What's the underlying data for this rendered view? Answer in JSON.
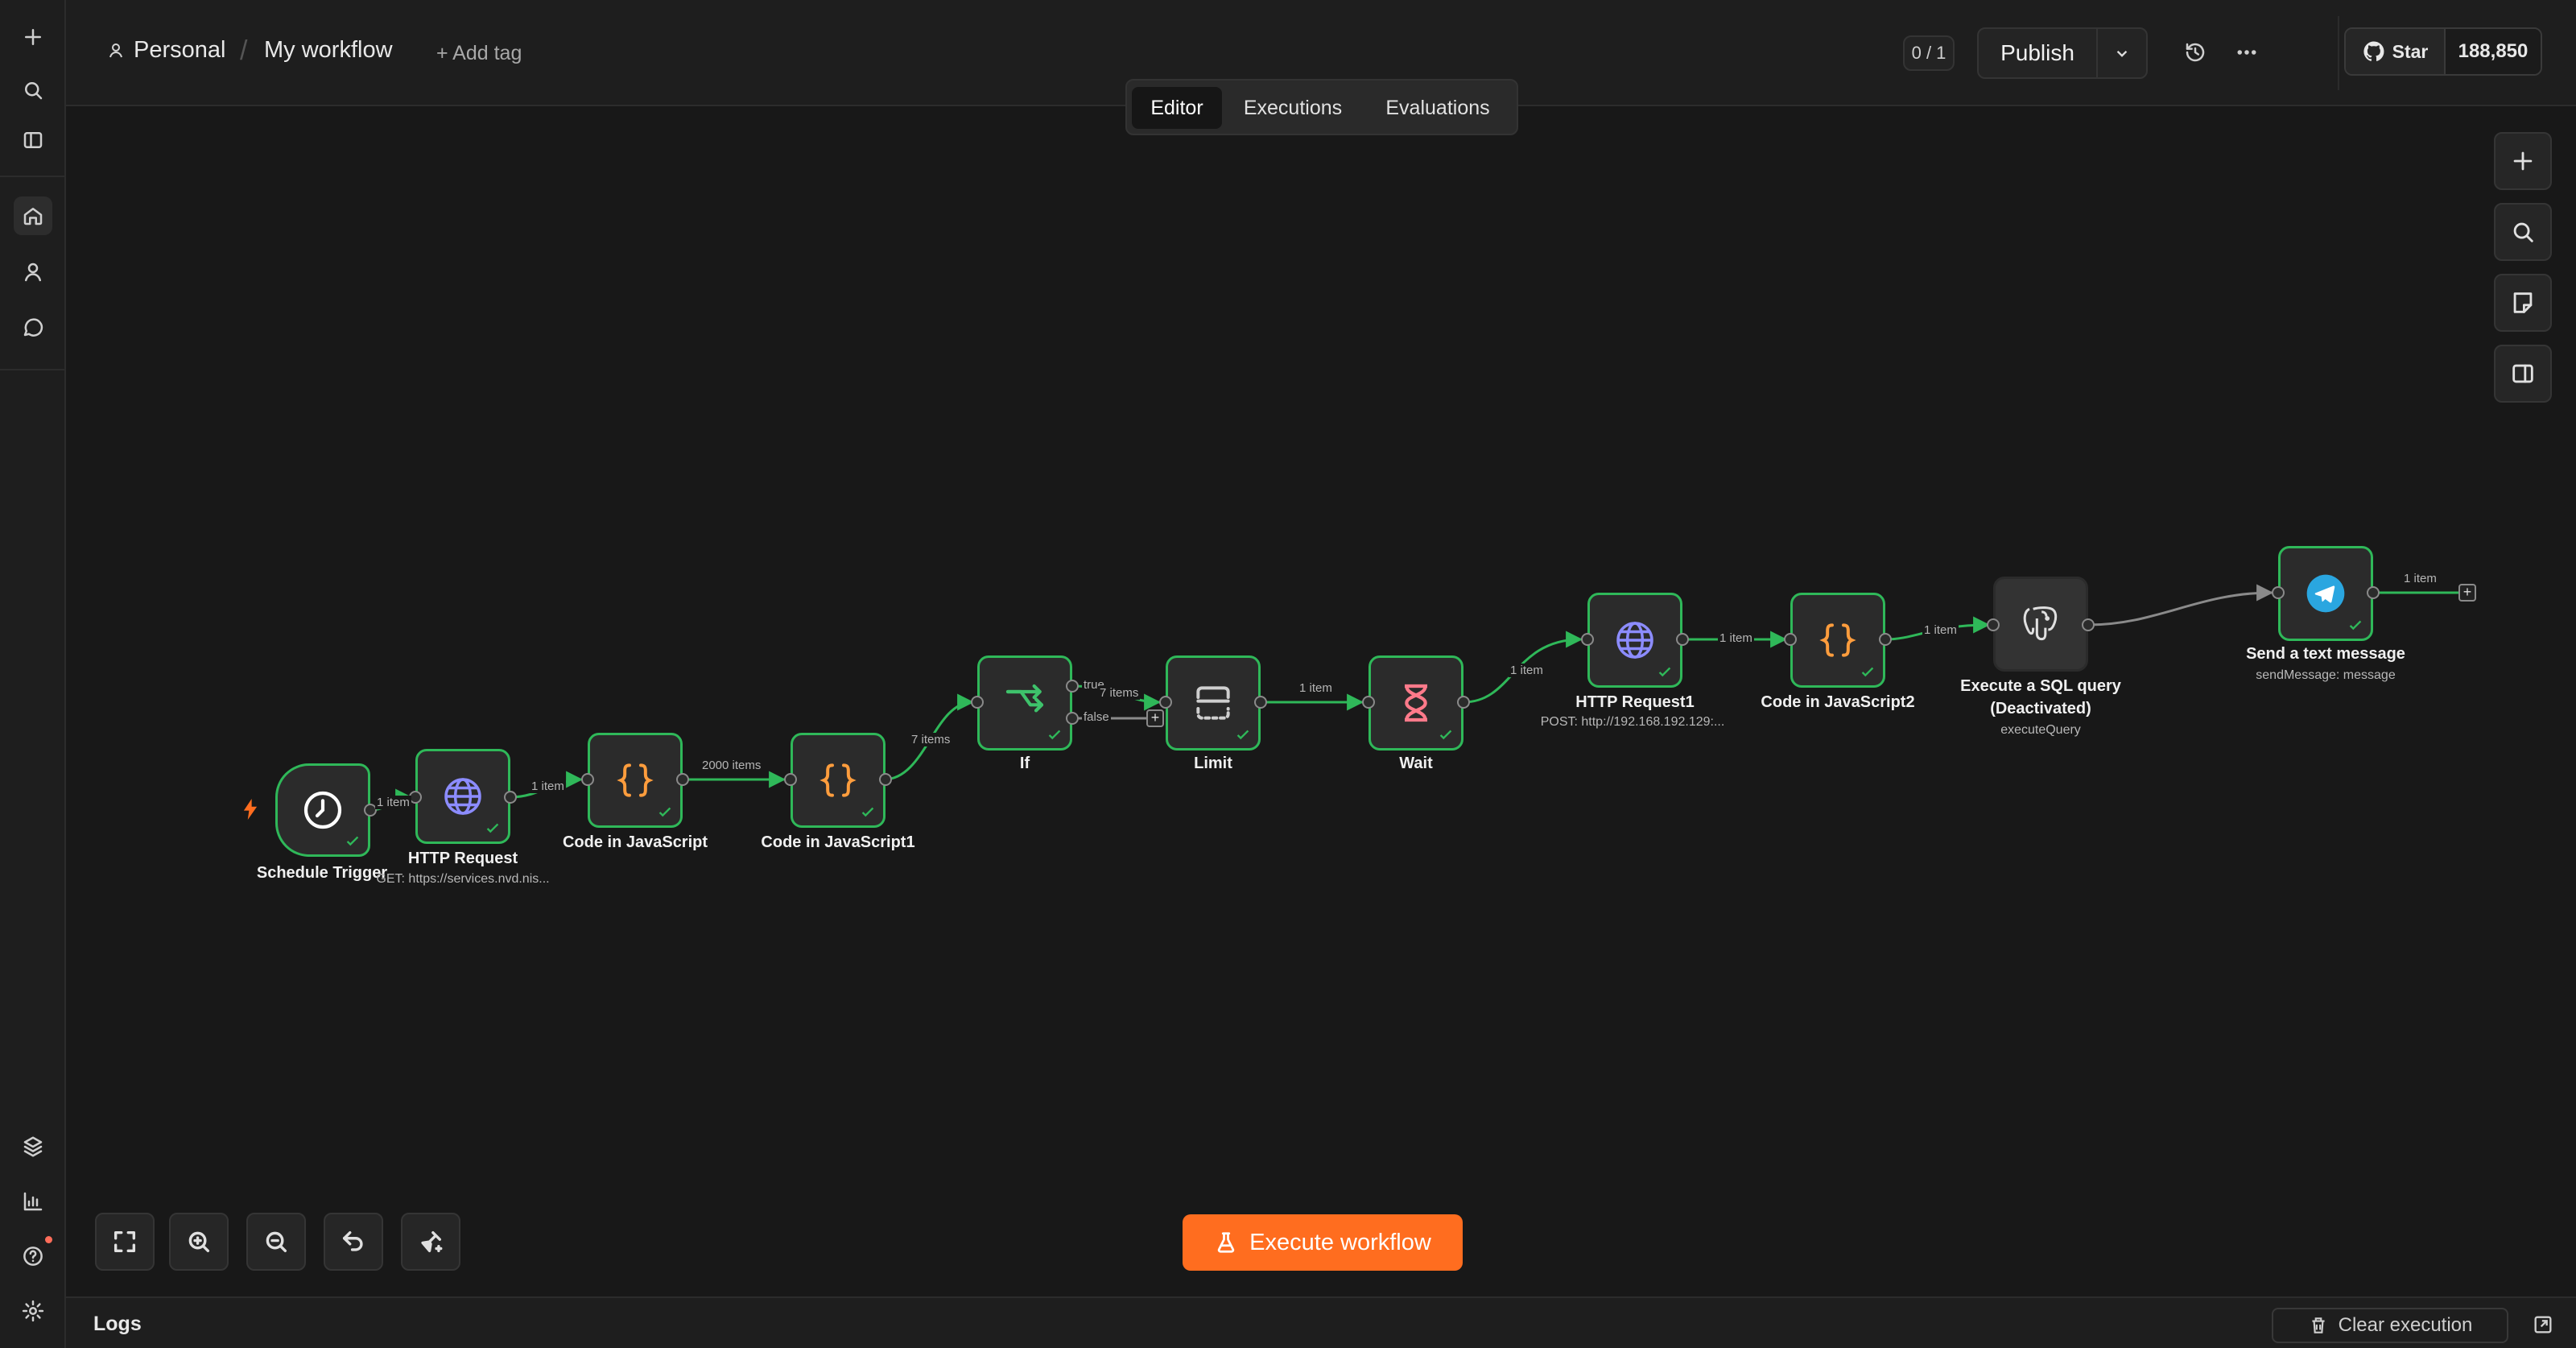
{
  "header": {
    "project": "Personal",
    "workflow_name": "My workflow",
    "add_tag": "+ Add tag",
    "counter": "0 / 1",
    "publish": "Publish"
  },
  "tabs": [
    {
      "label": "Editor",
      "active": true
    },
    {
      "label": "Executions",
      "active": false
    },
    {
      "label": "Evaluations",
      "active": false
    }
  ],
  "github": {
    "star": "Star",
    "count": "188,850"
  },
  "nodes": [
    {
      "id": "schedule",
      "label": "Schedule Trigger",
      "icon": "clock-icon",
      "color": "#ffffff"
    },
    {
      "id": "http1",
      "label": "HTTP Request",
      "sub": "GET: https://services.nvd.nis...",
      "icon": "globe-icon",
      "color": "#8c8cff"
    },
    {
      "id": "code1",
      "label": "Code in JavaScript",
      "icon": "braces-icon",
      "color": "#ff9d3d"
    },
    {
      "id": "code2",
      "label": "Code in JavaScript1",
      "icon": "braces-icon",
      "color": "#ff9d3d"
    },
    {
      "id": "if",
      "label": "If",
      "icon": "branch-icon",
      "color": "#3ec26b"
    },
    {
      "id": "limit",
      "label": "Limit",
      "icon": "limit-icon",
      "color": "#c8c8c8"
    },
    {
      "id": "wait",
      "label": "Wait",
      "icon": "hourglass-icon",
      "color": "#ff7a8a"
    },
    {
      "id": "http2",
      "label": "HTTP Request1",
      "sub": "POST: http://192.168.192.129:...",
      "icon": "globe-icon",
      "color": "#8c8cff"
    },
    {
      "id": "code3",
      "label": "Code in JavaScript2",
      "icon": "braces-icon",
      "color": "#ff9d3d"
    },
    {
      "id": "sql",
      "label": "Execute a SQL query",
      "label2": "(Deactivated)",
      "sub": "executeQuery",
      "icon": "postgres-icon",
      "color": "#d0d0d0"
    },
    {
      "id": "telegram",
      "label": "Send a text message",
      "sub": "sendMessage: message",
      "icon": "telegram-icon",
      "color": "#2aa6e0"
    }
  ],
  "edges": {
    "e1": "1 item",
    "e2": "1 item",
    "e3": "2000 items",
    "e4": "7 items",
    "if_true": "true",
    "if_items": "7 items",
    "if_false": "false",
    "e6": "1 item",
    "e7": "1 item",
    "e8": "1 item",
    "e9": "1 item",
    "e11": "1 item"
  },
  "actions": {
    "execute": "Execute workflow"
  },
  "logs": {
    "title": "Logs",
    "clear": "Clear execution"
  },
  "colors": {
    "accent": "#ff6d1f",
    "success": "#2fb859",
    "canvas": "#181818"
  }
}
